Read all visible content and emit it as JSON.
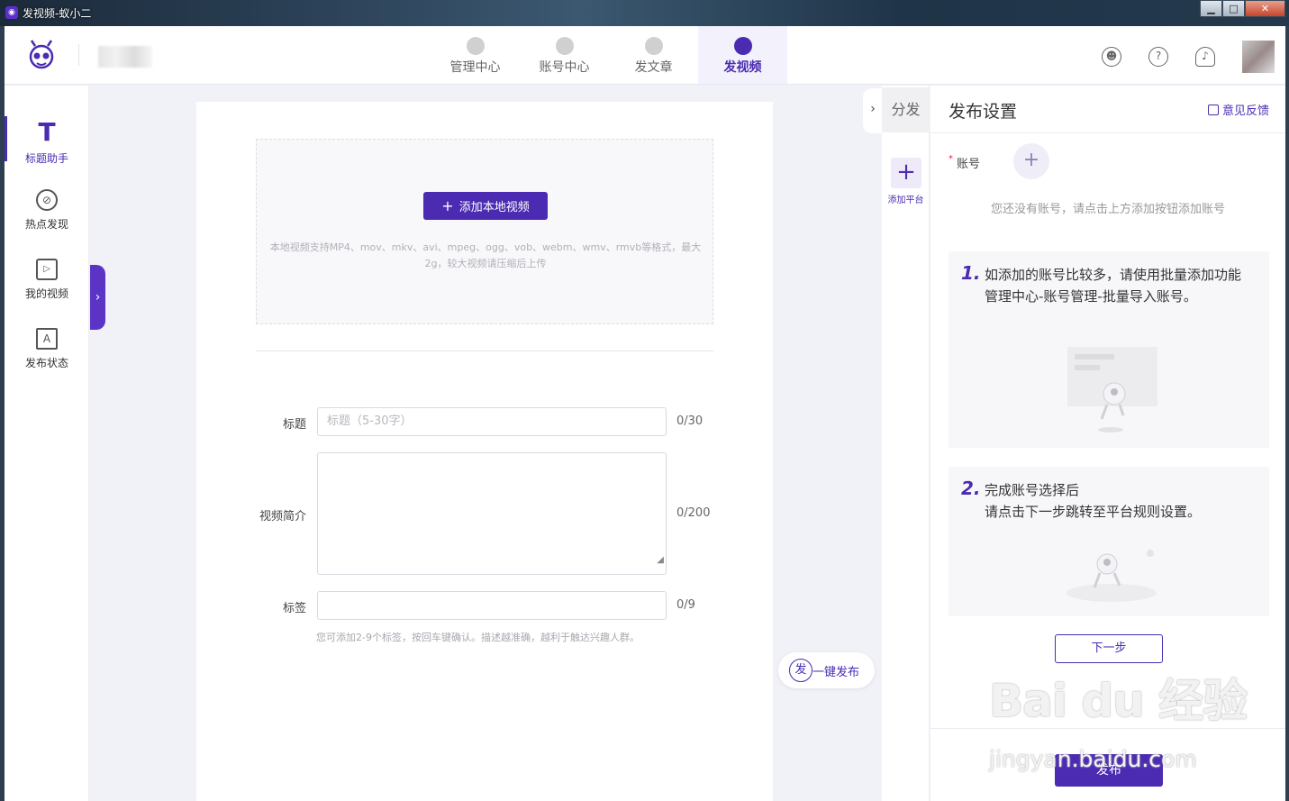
{
  "window": {
    "title": "发视频-蚁小二",
    "min": "▁",
    "max": "□",
    "close": "✕"
  },
  "nav": [
    {
      "label": "管理中心"
    },
    {
      "label": "账号中心"
    },
    {
      "label": "发文章"
    },
    {
      "label": "发视频"
    }
  ],
  "sidebar": [
    {
      "label": "标题助手",
      "icon": "T"
    },
    {
      "label": "热点发现",
      "icon": "⊘"
    },
    {
      "label": "我的视频",
      "icon": "▷"
    },
    {
      "label": "发布状态",
      "icon": "A"
    }
  ],
  "upload": {
    "button": "添加本地视频",
    "hint": "本地视频支持MP4、mov、mkv、avi、mpeg、ogg、vob、webm、wmv、rmvb等格式，最大2g，较大视频请压缩后上传"
  },
  "form": {
    "title_label": "标题",
    "title_placeholder": "标题（5-30字）",
    "title_count": "0/30",
    "desc_label": "视频简介",
    "desc_count": "0/200",
    "tag_label": "标签",
    "tag_count": "0/9",
    "tag_hint": "您可添加2-9个标签，按回车键确认。描述越准确，越利于触达兴趣人群。"
  },
  "onekey": {
    "icon": "发",
    "label": "一键发布"
  },
  "distribute": {
    "tab": "分发",
    "add_label": "添加平台"
  },
  "panel": {
    "title": "发布设置",
    "feedback": "意见反馈",
    "account_label": "账号",
    "account_required": "*",
    "empty_text": "您还没有账号，请点击上方添加按钮添加账号",
    "step1_num": "1.",
    "step1_line1": "如添加的账号比较多，请使用批量添加功能",
    "step1_line2": "管理中心-账号管理-批量导入账号。",
    "step2_num": "2.",
    "step2_line1": "完成账号选择后",
    "step2_line2": "请点击下一步跳转至平台规则设置。",
    "next_button": "下一步",
    "publish_button": "发布"
  },
  "watermark": {
    "line1": "Bai du 经验",
    "line2": "jingyan.baidu.com"
  },
  "colors": {
    "accent": "#4a2bb1"
  }
}
